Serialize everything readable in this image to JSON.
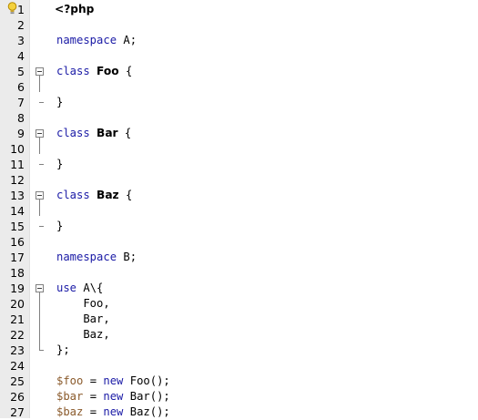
{
  "editor": {
    "line_numbers": [
      "1",
      "2",
      "3",
      "4",
      "5",
      "6",
      "7",
      "8",
      "9",
      "10",
      "11",
      "12",
      "13",
      "14",
      "15",
      "16",
      "17",
      "18",
      "19",
      "20",
      "21",
      "22",
      "23",
      "24",
      "25",
      "26",
      "27"
    ],
    "hint_icon": "lightbulb-icon",
    "fold_icon": "fold-collapse-icon",
    "code": {
      "php_open": "<?php",
      "ns_a_kw": "namespace",
      "ns_a_rest": " A;",
      "foo_kw": "class",
      "foo_name": "Foo",
      "foo_brace": " {",
      "foo_close": "}",
      "bar_kw": "class",
      "bar_name": "Bar",
      "bar_brace": " {",
      "bar_close": "}",
      "baz_kw": "class",
      "baz_name": "Baz",
      "baz_brace": " {",
      "baz_close": "}",
      "ns_b_kw": "namespace",
      "ns_b_rest": " B;",
      "use_kw": "use",
      "use_rest": " A\\{",
      "use_item_1": "    Foo,",
      "use_item_2": "    Bar,",
      "use_item_3": "    Baz,",
      "use_close": "};",
      "l25_var": "$foo",
      "l25_eq": " = ",
      "l25_new": "new",
      "l25_rest": " Foo();",
      "l26_var": "$bar",
      "l26_eq": " = ",
      "l26_new": "new",
      "l26_rest": " Bar();",
      "l27_var": "$baz",
      "l27_eq": " = ",
      "l27_new": "new",
      "l27_rest": " Baz();"
    }
  },
  "colors": {
    "keyword": "#1a1aa6",
    "variable": "#8a5a2b",
    "gutter": "#ebebeb"
  }
}
